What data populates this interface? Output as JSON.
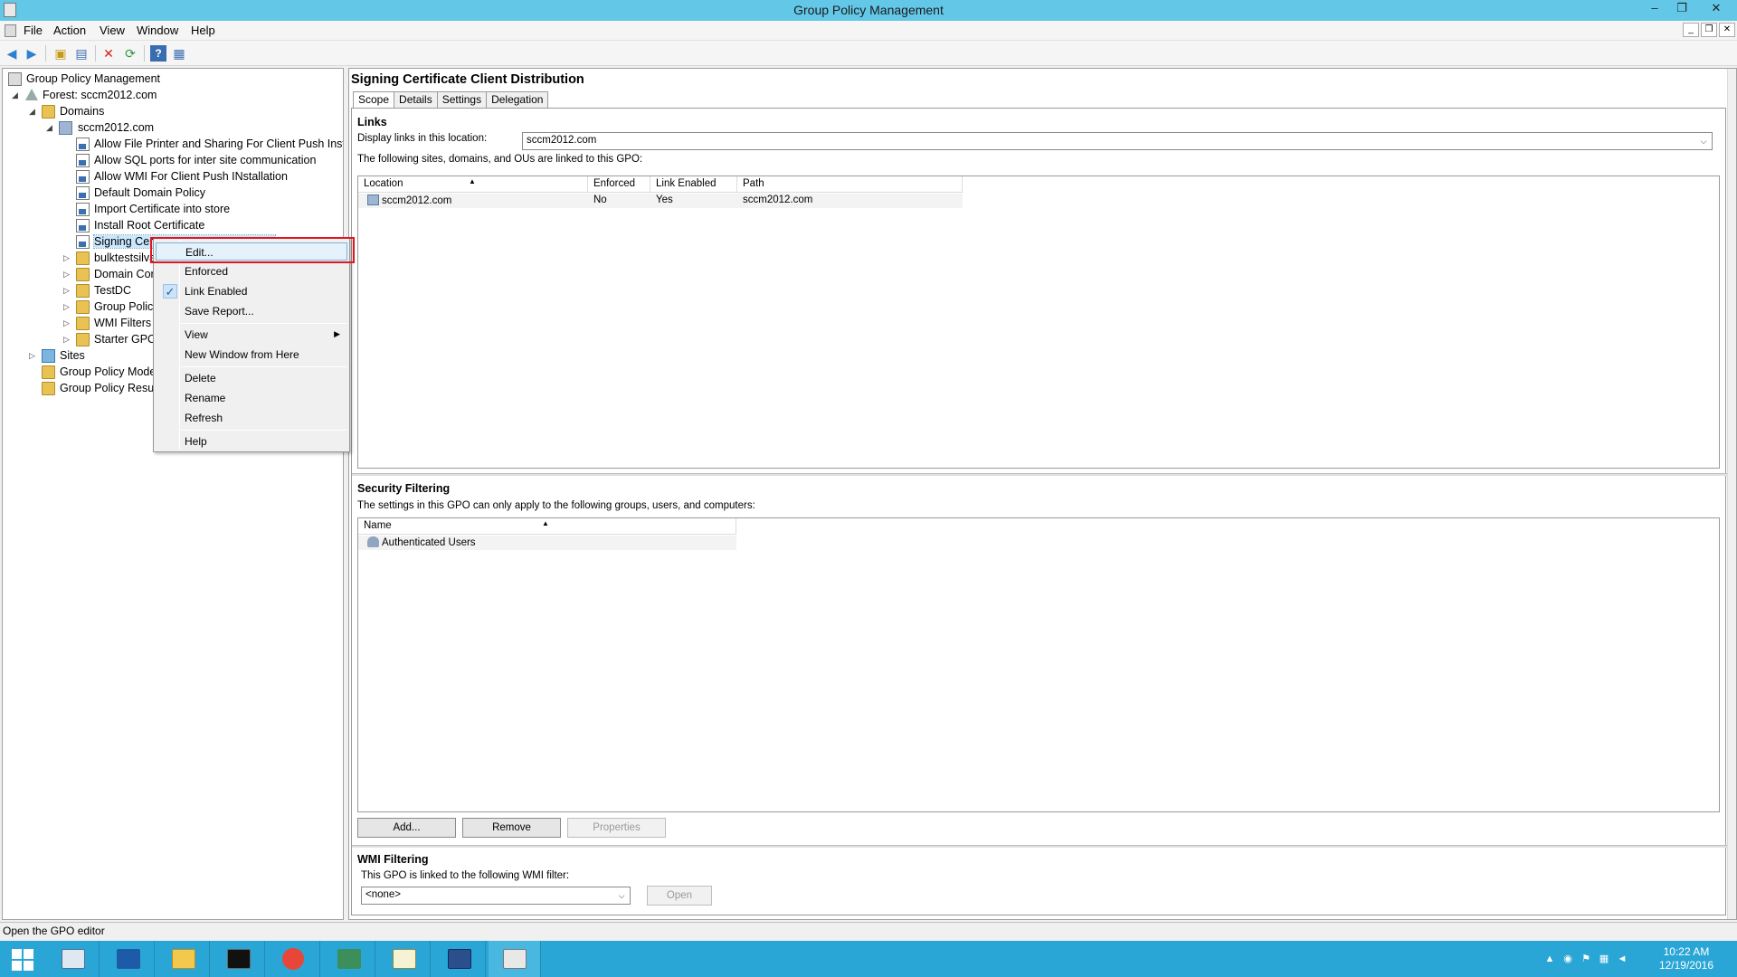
{
  "window": {
    "title": "Group Policy Management",
    "buttons": {
      "minimize": "–",
      "restore": "❐",
      "close": "✕"
    }
  },
  "menubar": {
    "items": [
      "File",
      "Action",
      "View",
      "Window",
      "Help"
    ]
  },
  "tree": {
    "items": [
      {
        "label": "Group Policy Management",
        "icon": "gpm-icon"
      },
      {
        "label": "Forest: sccm2012.com",
        "icon": "forest-icon"
      },
      {
        "label": "Domains",
        "icon": "folder-icon"
      },
      {
        "label": "sccm2012.com",
        "icon": "domain-icon"
      },
      {
        "label": "Allow File Printer and Sharing For Client Push Install",
        "icon": "gpo-link-icon"
      },
      {
        "label": "Allow SQL ports for inter site communication",
        "icon": "gpo-link-icon"
      },
      {
        "label": "Allow WMI For Client Push INstallation",
        "icon": "gpo-link-icon"
      },
      {
        "label": "Default Domain Policy",
        "icon": "gpo-link-icon"
      },
      {
        "label": "Import Certificate into store",
        "icon": "gpo-link-icon"
      },
      {
        "label": "Install Root Certificate",
        "icon": "gpo-link-icon"
      },
      {
        "label": "Signing Cert",
        "icon": "gpo-link-icon"
      },
      {
        "label": "bulktestsilva",
        "icon": "folder-icon"
      },
      {
        "label": "Domain Con",
        "icon": "folder-icon"
      },
      {
        "label": "TestDC",
        "icon": "folder-icon"
      },
      {
        "label": "Group Policy",
        "icon": "folder-icon"
      },
      {
        "label": "WMI Filters",
        "icon": "folder-icon"
      },
      {
        "label": "Starter GPOs",
        "icon": "folder-icon"
      },
      {
        "label": "Sites",
        "icon": "sites-icon"
      },
      {
        "label": "Group Policy Model",
        "icon": "folder-icon"
      },
      {
        "label": "Group Policy Result",
        "icon": "folder-icon"
      }
    ]
  },
  "context_menu": {
    "items": {
      "edit": "Edit...",
      "enforced": "Enforced",
      "link_enabled": "Link Enabled",
      "save_report": "Save Report...",
      "view": "View",
      "new_window": "New Window from Here",
      "delete": "Delete",
      "rename": "Rename",
      "refresh": "Refresh",
      "help": "Help"
    },
    "link_enabled_checked": true
  },
  "right_pane": {
    "title": "Signing Certificate Client Distribution",
    "tabs": [
      "Scope",
      "Details",
      "Settings",
      "Delegation"
    ],
    "active_tab": "Scope",
    "links": {
      "heading": "Links",
      "location_label": "Display links in this location:",
      "location_value": "sccm2012.com",
      "description": "The following sites, domains, and OUs are linked to this GPO:",
      "columns": [
        "Location",
        "Enforced",
        "Link Enabled",
        "Path"
      ],
      "rows": [
        {
          "location": "sccm2012.com",
          "enforced": "No",
          "link_enabled": "Yes",
          "path": "sccm2012.com"
        }
      ]
    },
    "security_filtering": {
      "heading": "Security Filtering",
      "description": "The settings in this GPO can only apply to the following groups, users, and computers:",
      "columns": [
        "Name"
      ],
      "rows": [
        "Authenticated Users"
      ],
      "buttons": {
        "add": "Add...",
        "remove": "Remove",
        "properties": "Properties"
      }
    },
    "wmi_filtering": {
      "heading": "WMI Filtering",
      "description": "This GPO is linked to the following WMI filter:",
      "filter_value": "<none>",
      "open_button": "Open"
    }
  },
  "statusbar": {
    "text": "Open the GPO editor"
  },
  "taskbar": {
    "clock_time": "10:22 AM",
    "clock_date": "12/19/2016"
  },
  "colors": {
    "titlebar": "#63c8e8",
    "taskbar": "#2aa6d6",
    "highlight_box": "#e0171f"
  }
}
